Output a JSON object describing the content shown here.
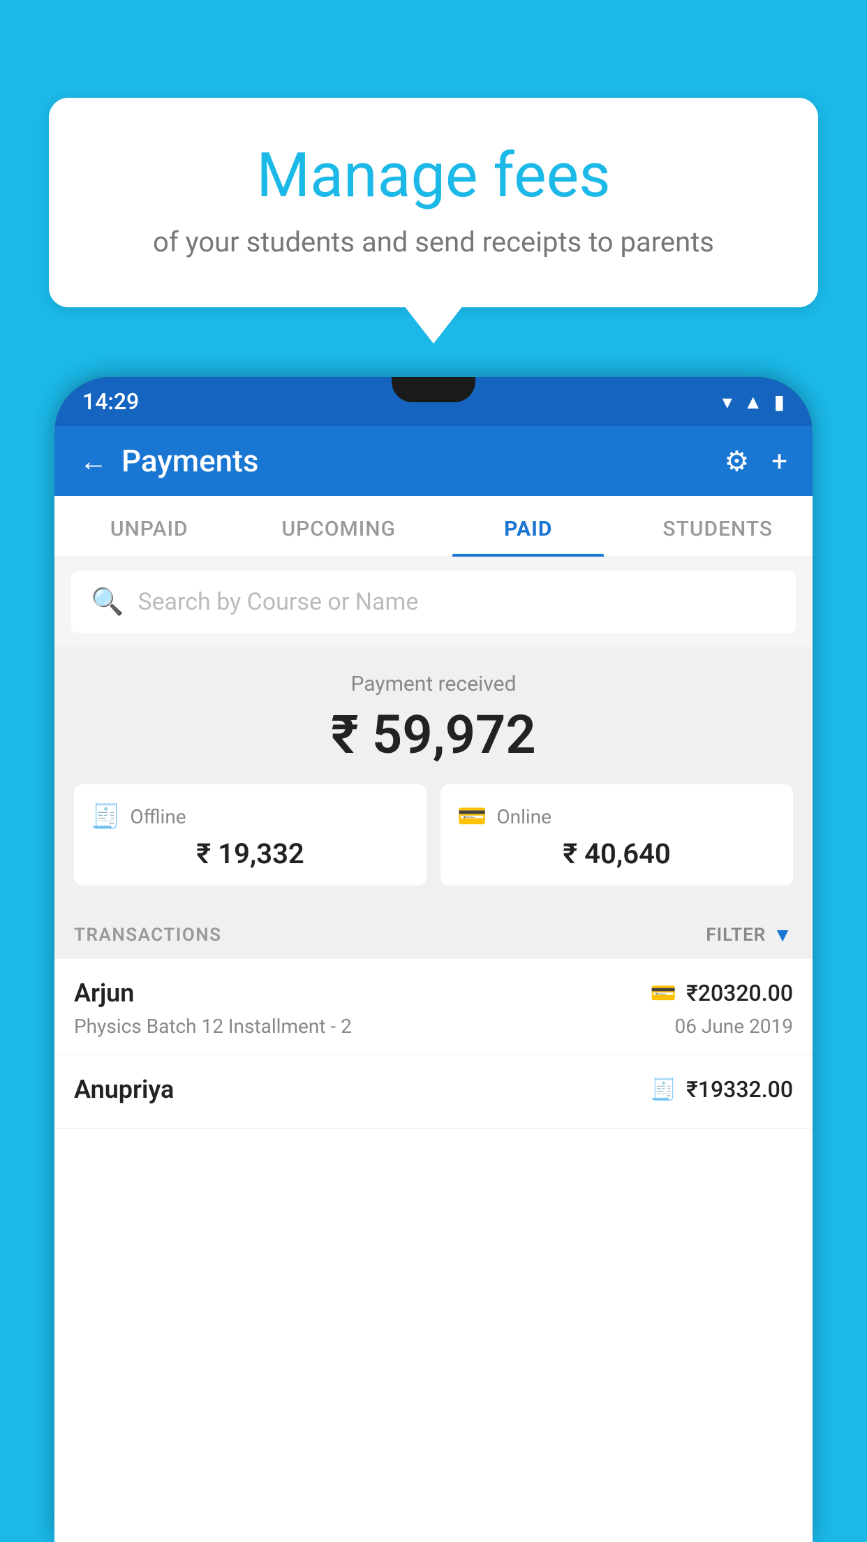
{
  "background_color": "#1BB8E8",
  "bubble": {
    "title": "Manage fees",
    "subtitle": "of your students and send receipts to parents"
  },
  "status_bar": {
    "time": "14:29",
    "icons": [
      "wifi",
      "signal",
      "battery"
    ]
  },
  "header": {
    "title": "Payments",
    "back_label": "←",
    "settings_label": "⚙",
    "add_label": "+"
  },
  "tabs": [
    {
      "label": "UNPAID",
      "active": false
    },
    {
      "label": "UPCOMING",
      "active": false
    },
    {
      "label": "PAID",
      "active": true
    },
    {
      "label": "STUDENTS",
      "active": false
    }
  ],
  "search": {
    "placeholder": "Search by Course or Name"
  },
  "payment_summary": {
    "received_label": "Payment received",
    "total_amount": "₹ 59,972",
    "offline_label": "Offline",
    "offline_amount": "₹ 19,332",
    "online_label": "Online",
    "online_amount": "₹ 40,640"
  },
  "transactions_header": {
    "label": "TRANSACTIONS",
    "filter_label": "FILTER"
  },
  "transactions": [
    {
      "name": "Arjun",
      "type_icon": "card",
      "amount": "₹20320.00",
      "detail": "Physics Batch 12 Installment - 2",
      "date": "06 June 2019"
    },
    {
      "name": "Anupriya",
      "type_icon": "cash",
      "amount": "₹19332.00",
      "detail": "",
      "date": ""
    }
  ]
}
